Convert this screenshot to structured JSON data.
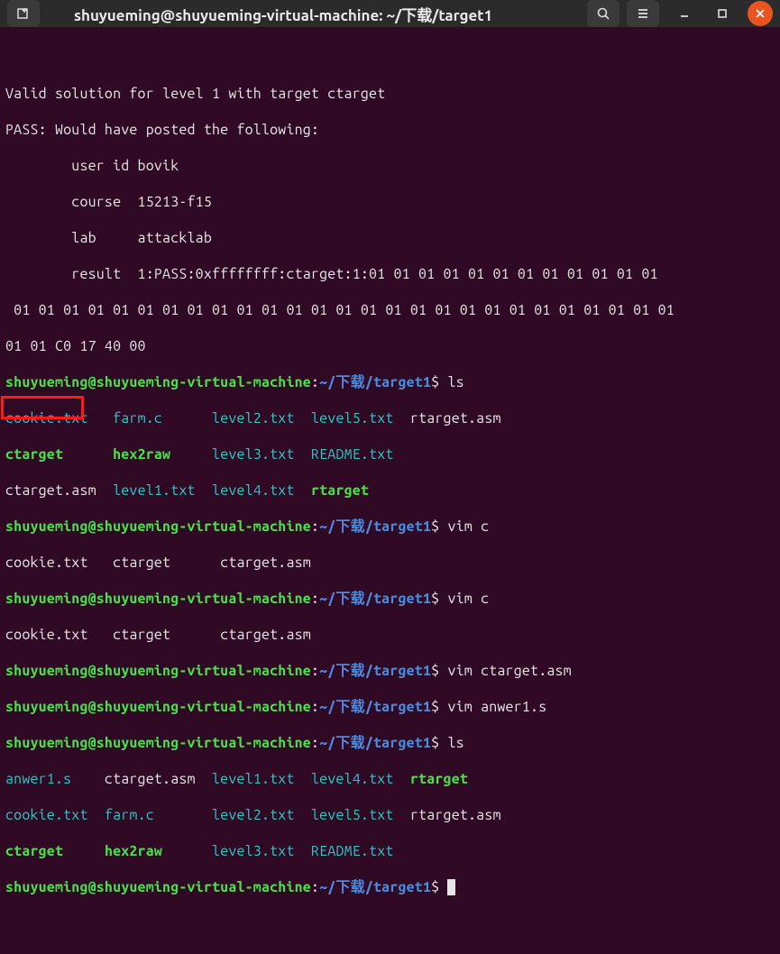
{
  "titlebar": {
    "title": "shuyueming@shuyueming-virtual-machine: ~/下载/target1"
  },
  "prompt": {
    "user_host": "shuyueming@shuyueming-virtual-machine",
    "colon": ":",
    "tilde": "~",
    "path": "/下载/target1",
    "dollar": "$"
  },
  "output": {
    "line1": "Valid solution for level 1 with target ctarget",
    "line2": "PASS: Would have posted the following:",
    "line3": "        user id bovik",
    "line4": "        course  15213-f15",
    "line5": "        lab     attacklab",
    "line6": "        result  1:PASS:0xffffffff:ctarget:1:01 01 01 01 01 01 01 01 01 01 01 01",
    "line7": " 01 01 01 01 01 01 01 01 01 01 01 01 01 01 01 01 01 01 01 01 01 01 01 01 01 01 01",
    "line8": "01 01 C0 17 40 00"
  },
  "cmds": {
    "ls": " ls",
    "vim_c": " vim c",
    "vim_ctarget": " vim ctarget.asm",
    "vim_anwer": " vim anwer1.s"
  },
  "ls1": {
    "r1c1": "cookie.txt",
    "r1c2": "farm.c",
    "r1c3": "level2.txt",
    "r1c4": "level5.txt",
    "r1c5": "rtarget.asm",
    "r2c1": "ctarget",
    "r2c2": "hex2raw",
    "r2c3": "level3.txt",
    "r2c4": "README.txt",
    "r3c1": "ctarget.asm",
    "r3c2": "level1.txt",
    "r3c3": "level4.txt",
    "r3c4": "rtarget"
  },
  "tabc1": {
    "c1": "cookie.txt",
    "c2": "ctarget",
    "c3": "ctarget.asm"
  },
  "tabc2": {
    "c1": "cookie.txt",
    "c2": "ctarget",
    "c3": "ctarget.asm"
  },
  "ls2": {
    "r1c1": "anwer1.s",
    "r1c2": "ctarget.asm",
    "r1c3": "level1.txt",
    "r1c4": "level4.txt",
    "r1c5": "rtarget",
    "r2c1": "cookie.txt",
    "r2c2": "farm.c",
    "r2c3": "level2.txt",
    "r2c4": "level5.txt",
    "r2c5": "rtarget.asm",
    "r3c1": "ctarget",
    "r3c2": "hex2raw",
    "r3c3": "level3.txt",
    "r3c4": "README.txt"
  }
}
